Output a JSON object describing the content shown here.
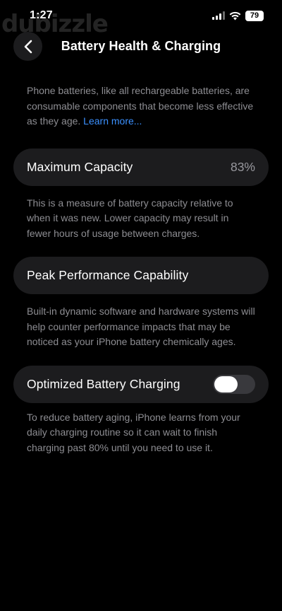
{
  "status_bar": {
    "time": "1:27",
    "watermark": "dubizzle",
    "battery_level": "79",
    "signal_bars_lit": 3
  },
  "nav": {
    "title": "Battery Health & Charging",
    "back_icon": "chevron-left-icon"
  },
  "intro": {
    "text": "Phone batteries, like all rechargeable batteries, are consumable components that become less effective as they age. ",
    "link": "Learn more..."
  },
  "max_capacity": {
    "label": "Maximum Capacity",
    "value": "83%",
    "footnote": "This is a measure of battery capacity relative to when it was new. Lower capacity may result in fewer hours of usage between charges."
  },
  "peak_performance": {
    "label": "Peak Performance Capability",
    "footnote": "Built-in dynamic software and hardware systems will help counter performance impacts that may be noticed as your iPhone battery chemically ages."
  },
  "optimized_charging": {
    "label": "Optimized Battery Charging",
    "enabled": false,
    "footnote": "To reduce battery aging, iPhone learns from your daily charging routine so it can wait to finish charging past 80% until you need to use it."
  },
  "colors": {
    "background": "#000000",
    "cell": "#1c1c1e",
    "secondary_text": "#8d8d92",
    "link": "#3b91ff"
  }
}
